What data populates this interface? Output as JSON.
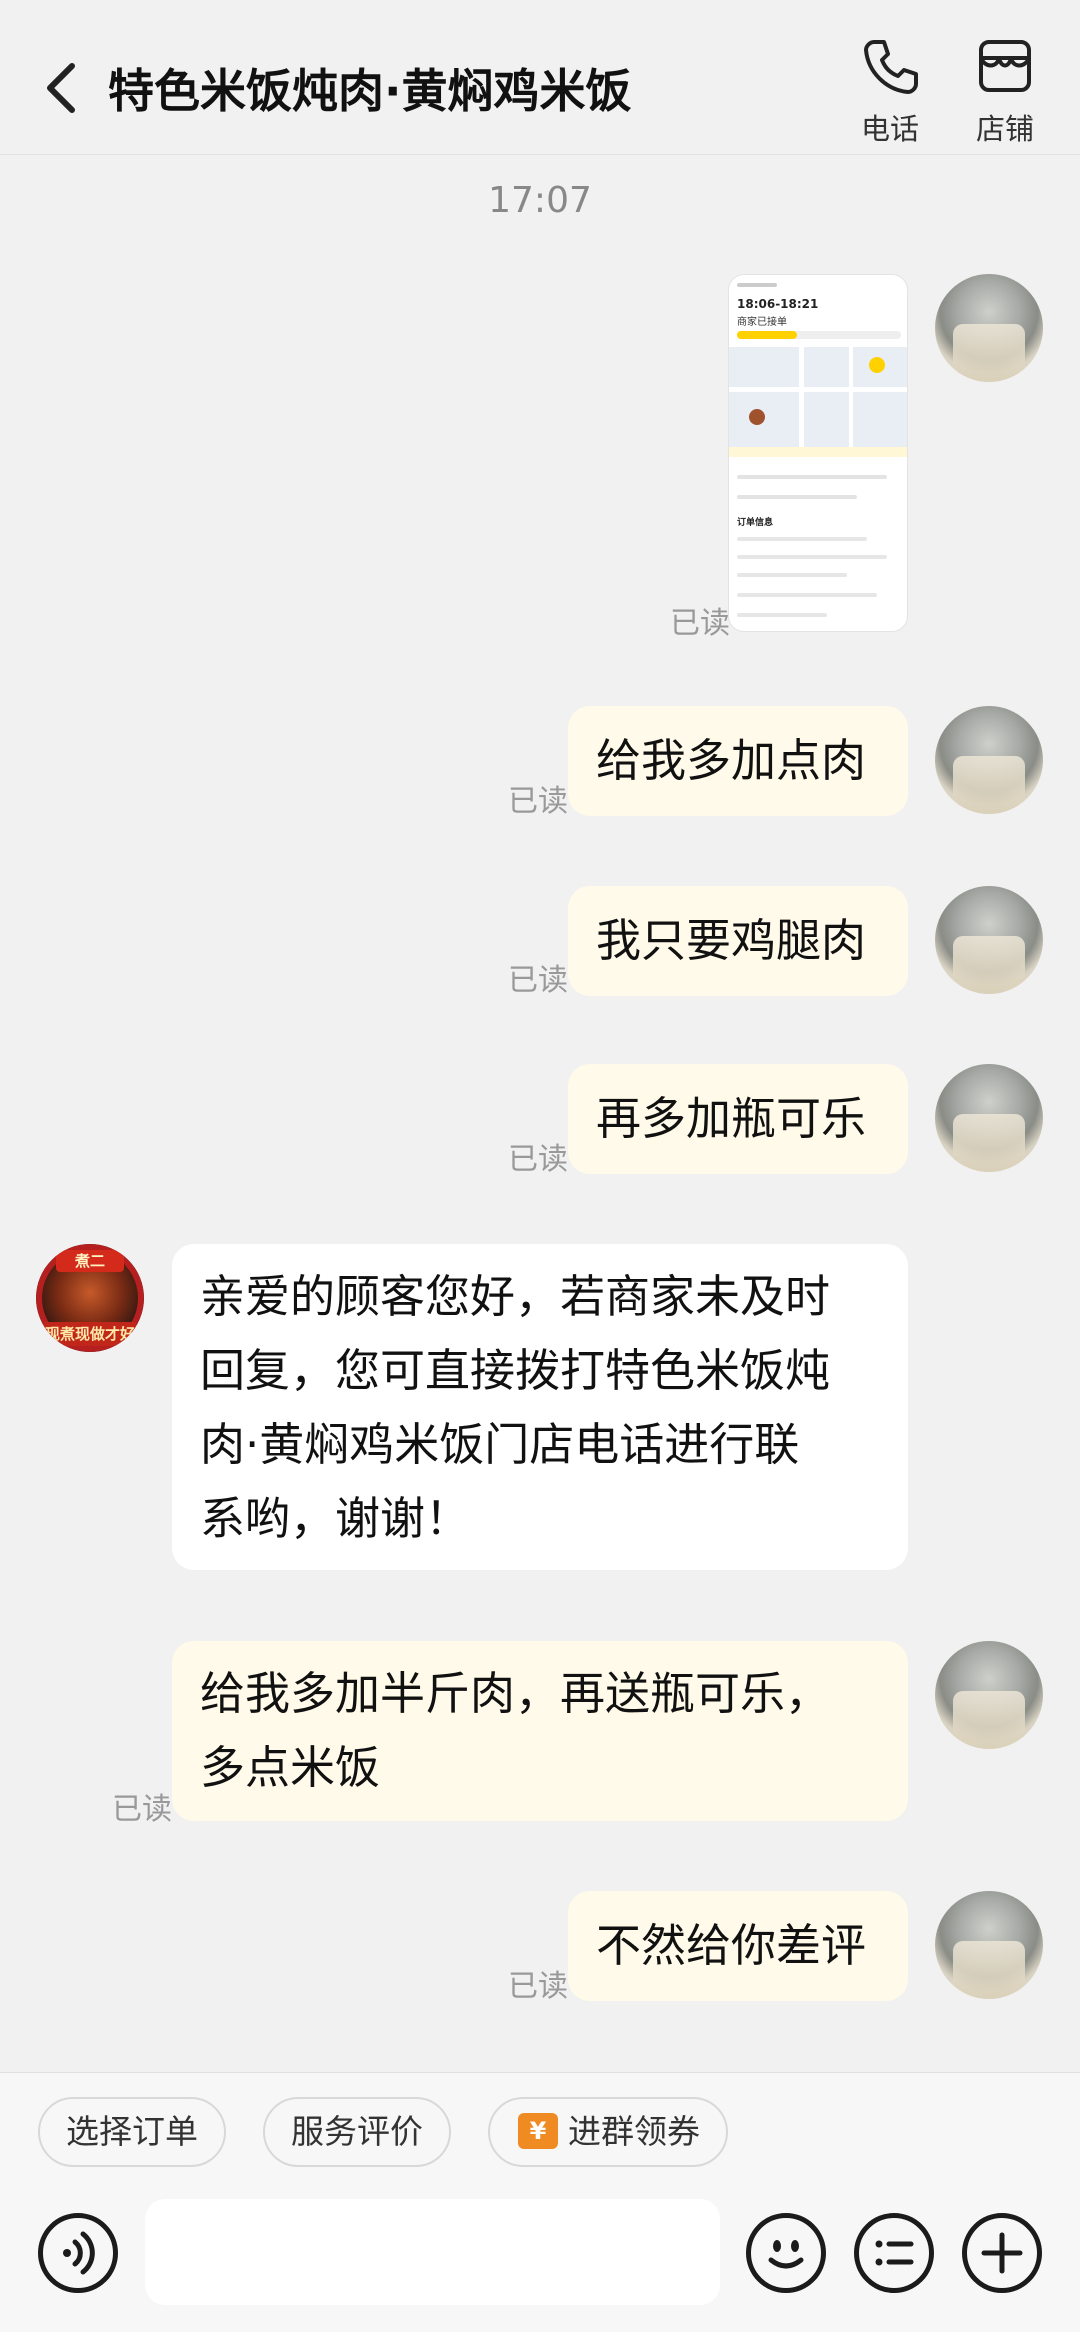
{
  "header": {
    "title": "特色米饭炖肉·黄焖鸡米饭",
    "actions": [
      {
        "label": "电话",
        "icon": "phone-icon"
      },
      {
        "label": "店铺",
        "icon": "store-icon"
      }
    ]
  },
  "chat": {
    "timestamp": "17:07",
    "read_label": "已读",
    "messages": [
      {
        "from": "me",
        "type": "image",
        "read": "已读",
        "thumb_time": "18:06-18:21",
        "thumb_sub": "商家已接单",
        "thumb_title": "订单信息"
      },
      {
        "from": "me",
        "type": "text",
        "text": "给我多加点肉",
        "read": "已读"
      },
      {
        "from": "me",
        "type": "text",
        "text": "我只要鸡腿肉",
        "read": "已读"
      },
      {
        "from": "me",
        "type": "text",
        "text": "再多加瓶可乐",
        "read": "已读"
      },
      {
        "from": "shop",
        "type": "text",
        "lines": [
          "亲爱的顾客您好，若商家未及时",
          "回复，您可直接拨打特色米饭炖",
          "肉·黄焖鸡米饭门店电话进行联",
          "系哟，谢谢！"
        ]
      },
      {
        "from": "me",
        "type": "text",
        "lines": [
          "给我多加半斤肉，再送瓶可乐，",
          "多点米饭"
        ],
        "read": "已读"
      },
      {
        "from": "me",
        "type": "text",
        "text": "不然给你差评",
        "read": "已读"
      }
    ]
  },
  "shop_avatar": {
    "top": "煮二",
    "banner": "现煮现做才好"
  },
  "quick_actions": [
    {
      "label": "选择订单"
    },
    {
      "label": "服务评价"
    },
    {
      "label": "进群领券",
      "icon": "coupon-icon",
      "icon_glyph": "¥"
    }
  ],
  "composer": {
    "placeholder": "",
    "icons": [
      "voice-icon",
      "emoji-icon",
      "quick-reply-icon",
      "plus-icon"
    ]
  },
  "colors": {
    "my_bubble": "#fffae9",
    "shop_bubble": "#ffffff",
    "background": "#f1f1f1",
    "coupon": "#f08a22"
  }
}
